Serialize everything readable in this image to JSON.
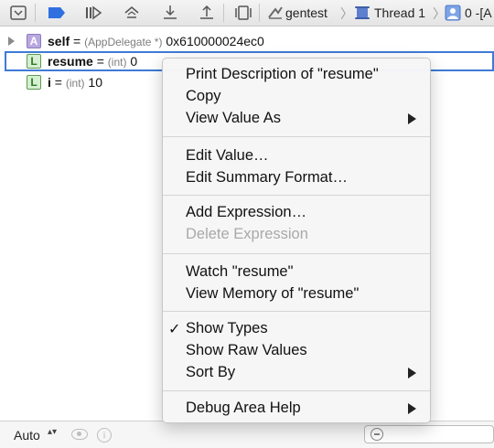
{
  "breadcrumb": {
    "target": "gentest",
    "thread": "Thread 1",
    "frame": "0 -[A"
  },
  "variables": [
    {
      "badge": "A",
      "name": "self",
      "eq": " = ",
      "type": "(AppDelegate *)",
      "value": " 0x610000024ec0"
    },
    {
      "badge": "L",
      "name": "resume",
      "eq": " = ",
      "type": "(int)",
      "value": " 0"
    },
    {
      "badge": "L",
      "name": "i",
      "eq": " = ",
      "type": "(int)",
      "value": " 10"
    }
  ],
  "bottom_bar": {
    "scope_label": "Auto",
    "stepper_glyph": "▴▾",
    "info_glyph": "i"
  },
  "context_menu": {
    "items": [
      {
        "label": "Print Description of \"resume\""
      },
      {
        "label": "Copy"
      },
      {
        "label": "View Value As"
      },
      {
        "label": "Edit Value…"
      },
      {
        "label": "Edit Summary Format…"
      },
      {
        "label": "Add Expression…"
      },
      {
        "label": "Delete Expression"
      },
      {
        "label": "Watch \"resume\""
      },
      {
        "label": "View Memory of \"resume\""
      },
      {
        "label": "Show Types",
        "check": "✓"
      },
      {
        "label": "Show Raw Values"
      },
      {
        "label": "Sort By"
      },
      {
        "label": "Debug Area Help"
      }
    ]
  },
  "colors": {
    "selection_border": "#3e7bd6",
    "breakpoint_blue": "#2f6fe0",
    "disabled_text": "#a9a9a9"
  }
}
